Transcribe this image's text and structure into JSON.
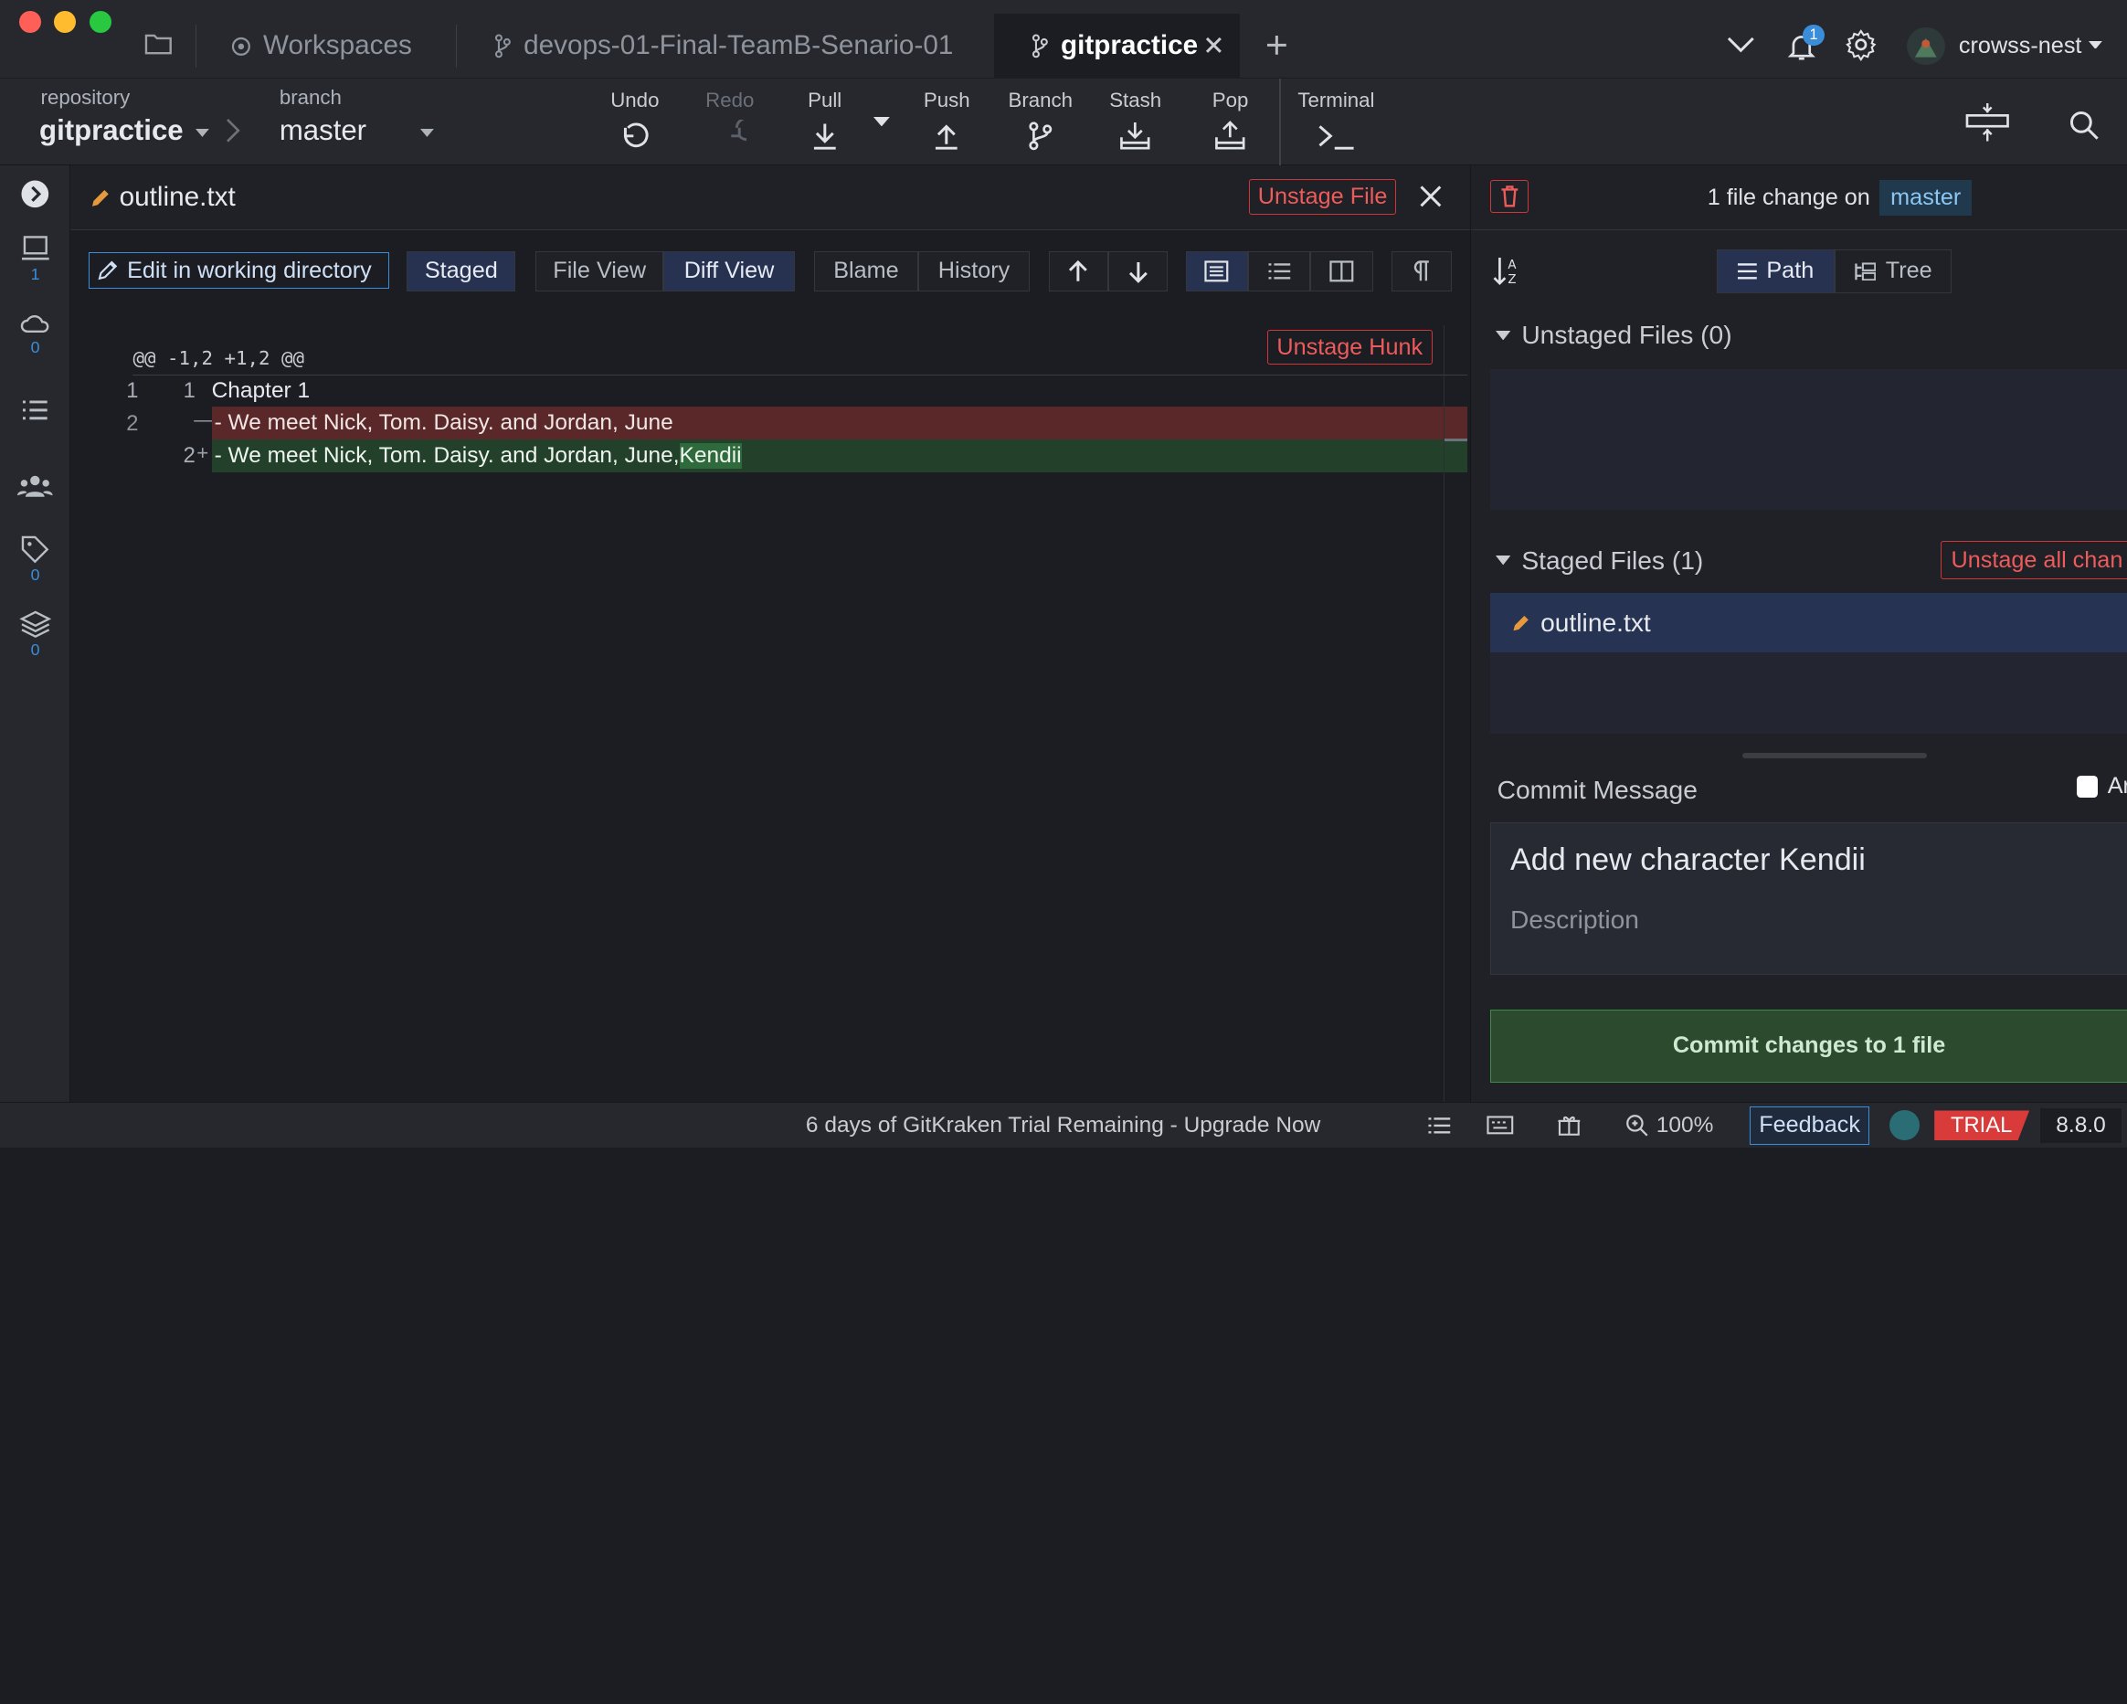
{
  "titlebar": {
    "tabs": [
      {
        "label": "Workspaces"
      },
      {
        "label": "devops-01-Final-TeamB-Senario-01"
      },
      {
        "label": "gitpractice"
      }
    ],
    "notification_count": "1",
    "user": "crowss-nest"
  },
  "toolbar": {
    "repository_label": "repository",
    "repository": "gitpractice",
    "branch_label": "branch",
    "branch": "master",
    "undo": "Undo",
    "redo": "Redo",
    "pull": "Pull",
    "push": "Push",
    "branch_btn": "Branch",
    "stash": "Stash",
    "pop": "Pop",
    "terminal": "Terminal"
  },
  "rail": {
    "local_count": "1",
    "remote_count": "0",
    "tags_count": "0",
    "submodules_count": "0"
  },
  "diff": {
    "filename": "outline.txt",
    "unstage_file": "Unstage File",
    "edit_btn": "Edit in working directory",
    "staged": "Staged",
    "file_view": "File View",
    "diff_view": "Diff View",
    "blame": "Blame",
    "history": "History",
    "unstage_hunk": "Unstage Hunk",
    "hunk_header": "@@ -1,2 +1,2 @@",
    "lines": [
      {
        "old": "1",
        "new": "1",
        "marker": "",
        "text": "Chapter 1"
      },
      {
        "old": "2",
        "new": "",
        "marker": "—",
        "text": "- We meet Nick, Tom. Daisy. and Jordan, June"
      },
      {
        "old": "",
        "new": "2",
        "marker": "+",
        "text_pre": "- We meet Nick, Tom. Daisy. and Jordan, June,",
        "text_added": " Kendii"
      }
    ]
  },
  "right": {
    "summary_pre": "1 file change on",
    "summary_branch": "master",
    "path": "Path",
    "tree": "Tree",
    "unstaged_header": "Unstaged Files (0)",
    "staged_header": "Staged Files (1)",
    "unstage_all": "Unstage all chan",
    "staged_files": [
      "outline.txt"
    ],
    "commit_label": "Commit Message",
    "amend_label": "Ar",
    "commit_summary": "Add new character Kendii",
    "description_placeholder": "Description",
    "commit_button": "Commit changes to 1 file"
  },
  "status": {
    "trial_msg": "6 days of GitKraken Trial Remaining - Upgrade Now",
    "zoom": "100%",
    "feedback": "Feedback",
    "trial": "TRIAL",
    "version": "8.8.0"
  },
  "colors": {
    "accent": "#3a8dd8",
    "danger": "#d03636",
    "removed_bg": "#5a2828",
    "added_bg": "#22402a",
    "commit_green": "#2b4a2e"
  }
}
